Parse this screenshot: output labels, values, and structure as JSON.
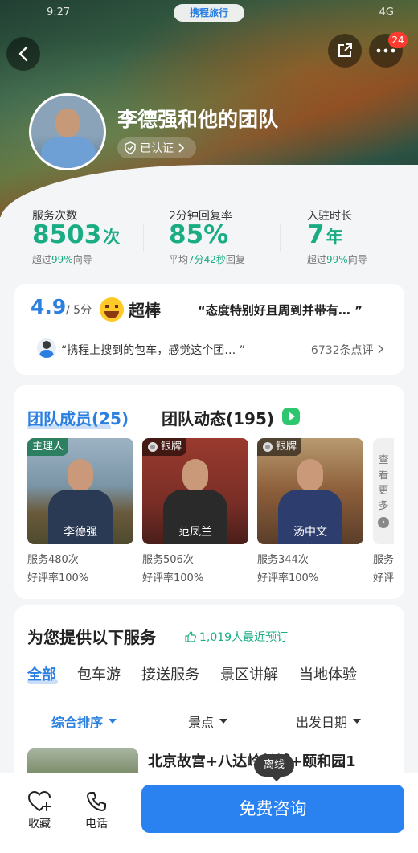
{
  "status_bar": {
    "time": "9:27",
    "signal": "4G"
  },
  "brand": "携程旅行",
  "header": {
    "notif_count": "24",
    "team_name": "李德强和他的团队",
    "verified": "已认证"
  },
  "stats": [
    {
      "label": "服务次数",
      "value": "8503",
      "unit": "次",
      "sub_prefix": "超过",
      "sub_hl": "99%",
      "sub_suffix": "向导"
    },
    {
      "label": "2分钟回复率",
      "value": "85%",
      "unit": "",
      "sub_prefix": "平均",
      "sub_hl": "7分42秒",
      "sub_suffix": "回复"
    },
    {
      "label": "入驻时长",
      "value": "7",
      "unit": "年",
      "sub_prefix": "超过",
      "sub_hl": "99%",
      "sub_suffix": "向导"
    }
  ],
  "review": {
    "score": "4.9",
    "out_of": "/ 5分",
    "word": "超棒",
    "quote_top": "“态度特别好且周到并带有…  ”",
    "quote_bottom": "“携程上搜到的包车，感觉这个团…  ”",
    "count": "6732条点评"
  },
  "team": {
    "tab_members": "团队成员(25)",
    "tab_dynamics": "团队动态(195)",
    "members": [
      {
        "name": "李德强",
        "tag": "主理人",
        "services": "服务480次",
        "rate": "好评率100%",
        "bg": "#6f8aa0",
        "shirt": "#2a3a55"
      },
      {
        "name": "范凤兰",
        "tag": "银牌",
        "services": "服务506次",
        "rate": "好评率100%",
        "bg": "#7a2e26",
        "shirt": "#2a2a2a"
      },
      {
        "name": "汤中文",
        "tag": "银牌",
        "services": "服务344次",
        "rate": "好评率100%",
        "bg": "#8c5e3a",
        "shirt": "#2d3e6e"
      }
    ],
    "see_more": [
      "查",
      "看",
      "更",
      "多"
    ],
    "clip_stats": [
      "服务",
      "好评"
    ]
  },
  "services": {
    "title": "为您提供以下服务",
    "booked": "1,019人最近预订",
    "tabs": [
      "全部",
      "包车游",
      "接送服务",
      "景区讲解",
      "当地体验"
    ],
    "filters": [
      "综合排序",
      "景点",
      "出发日期"
    ],
    "product_title": "北京故宫+八达岭长城+颐和园1"
  },
  "bottom": {
    "favorite": "收藏",
    "phone": "电话",
    "consult": "免费咨询",
    "offline": "离线"
  },
  "colors": {
    "accent": "#2a7fe0",
    "green": "#1aad84",
    "badge": "#ff3b30"
  }
}
